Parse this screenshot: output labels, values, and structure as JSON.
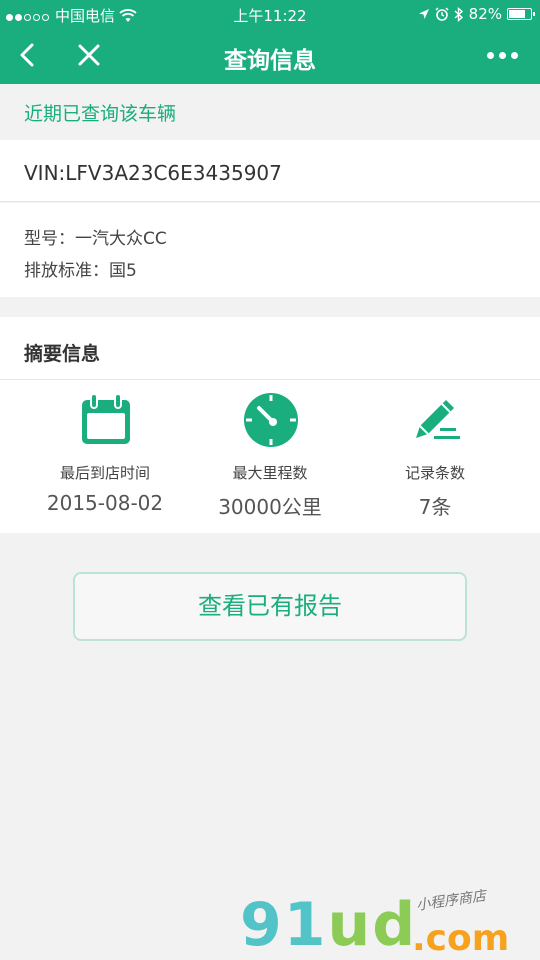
{
  "status_bar": {
    "carrier": "中国电信",
    "time": "上午11:22",
    "battery": "82%",
    "battery_level": 0.82
  },
  "nav": {
    "title": "查询信息"
  },
  "notice": "近期已查询该车辆",
  "vehicle": {
    "vin": "VIN:LFV3A23C6E3435907",
    "model": "型号：一汽大众CC",
    "emission": "排放标准：国5"
  },
  "summary": {
    "heading": "摘要信息",
    "stats": [
      {
        "icon": "calendar-icon",
        "label": "最后到店时间",
        "value": "2015-08-02"
      },
      {
        "icon": "speedometer-icon",
        "label": "最大里程数",
        "value": "30000公里"
      },
      {
        "icon": "pencil-icon",
        "label": "记录条数",
        "value": "7条"
      }
    ]
  },
  "report_button": "查看已有报告",
  "watermark": {
    "main_part1": "91",
    "main_part2": "ud",
    "suffix": ".com",
    "tagline": "小程序商店"
  },
  "colors": {
    "accent": "#1aad7e",
    "background": "#f2f2f2"
  }
}
